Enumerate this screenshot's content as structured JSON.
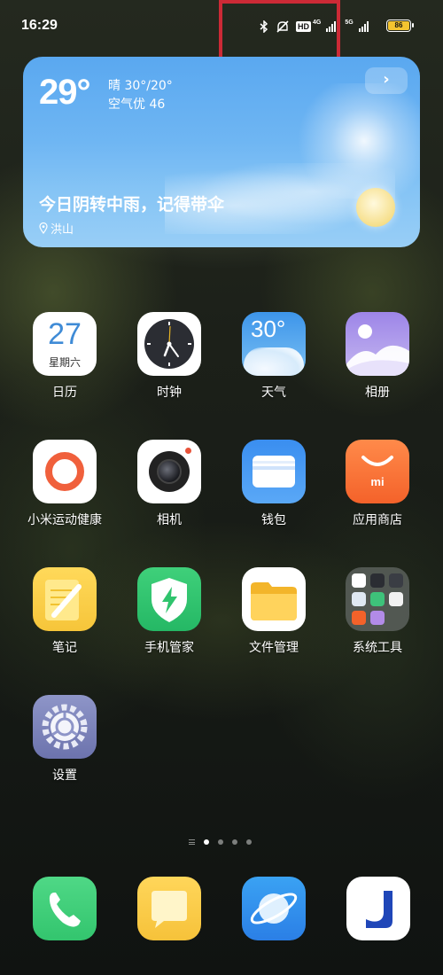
{
  "status_bar": {
    "time": "16:29",
    "hd_label": "HD",
    "net_4g": "4G",
    "net_5g": "5G",
    "battery": "86",
    "icons": [
      "bluetooth-icon",
      "silent-icon",
      "hd-voice-icon",
      "signal-icon",
      "signal-5g-icon",
      "battery-icon"
    ]
  },
  "weather": {
    "temp": "29°",
    "condition": "晴 30°/20°",
    "air": "空气优 46",
    "tip": "今日阴转中雨，记得带伞",
    "location": "洪山",
    "arrow": "›"
  },
  "calendar_icon": {
    "day": "27",
    "weekday": "星期六"
  },
  "weather_icon": {
    "temp": "30°"
  },
  "apps": [
    {
      "label": "日历"
    },
    {
      "label": "时钟"
    },
    {
      "label": "天气"
    },
    {
      "label": "相册"
    },
    {
      "label": "小米运动健康"
    },
    {
      "label": "相机"
    },
    {
      "label": "钱包"
    },
    {
      "label": "应用商店"
    },
    {
      "label": "笔记"
    },
    {
      "label": "手机管家"
    },
    {
      "label": "文件管理"
    },
    {
      "label": "系统工具"
    },
    {
      "label": "设置"
    }
  ],
  "store_icon_text": "mi",
  "pager": {
    "pages": 4,
    "active": 0
  },
  "dock": [
    "phone-icon",
    "messages-icon",
    "browser-icon",
    "app-j-icon"
  ],
  "colors": {
    "weather_top": "#5aa8f0",
    "highlight": "#cc2a36",
    "battery": "#f4c430"
  }
}
